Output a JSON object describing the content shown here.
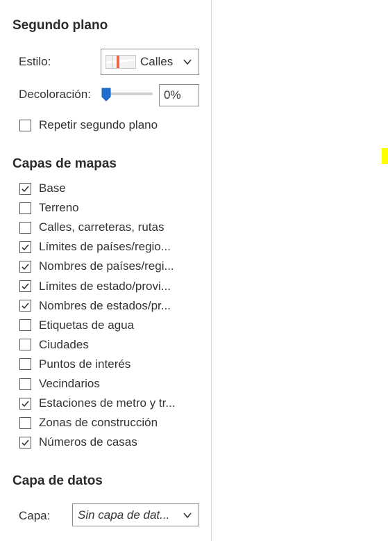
{
  "background": {
    "title": "Segundo plano",
    "style_label": "Estilo:",
    "style_value": "Calles",
    "fade_label": "Decoloración:",
    "fade_value": "0%",
    "fade_level": 0,
    "repeat_label": "Repetir segundo plano",
    "repeat_checked": false
  },
  "map_layers": {
    "title": "Capas de mapas",
    "items": [
      {
        "label": "Base",
        "checked": true
      },
      {
        "label": "Terreno",
        "checked": false
      },
      {
        "label": "Calles, carreteras, rutas",
        "checked": false
      },
      {
        "label": "Límites de países/regio...",
        "checked": true
      },
      {
        "label": "Nombres de países/regi...",
        "checked": true
      },
      {
        "label": "Límites de estado/provi...",
        "checked": true
      },
      {
        "label": "Nombres de estados/pr...",
        "checked": true
      },
      {
        "label": "Etiquetas de agua",
        "checked": false
      },
      {
        "label": "Ciudades",
        "checked": false
      },
      {
        "label": "Puntos de interés",
        "checked": false
      },
      {
        "label": "Vecindarios",
        "checked": false
      },
      {
        "label": "Estaciones de metro y tr...",
        "checked": true
      },
      {
        "label": "Zonas de construcción",
        "checked": false
      },
      {
        "label": "Números de casas",
        "checked": true
      }
    ]
  },
  "data_layer": {
    "title": "Capa de datos",
    "layer_label": "Capa:",
    "layer_value": "Sin capa de dat..."
  },
  "colors": {
    "accent": "#1f6fd1",
    "highlight": "#ffff00"
  }
}
